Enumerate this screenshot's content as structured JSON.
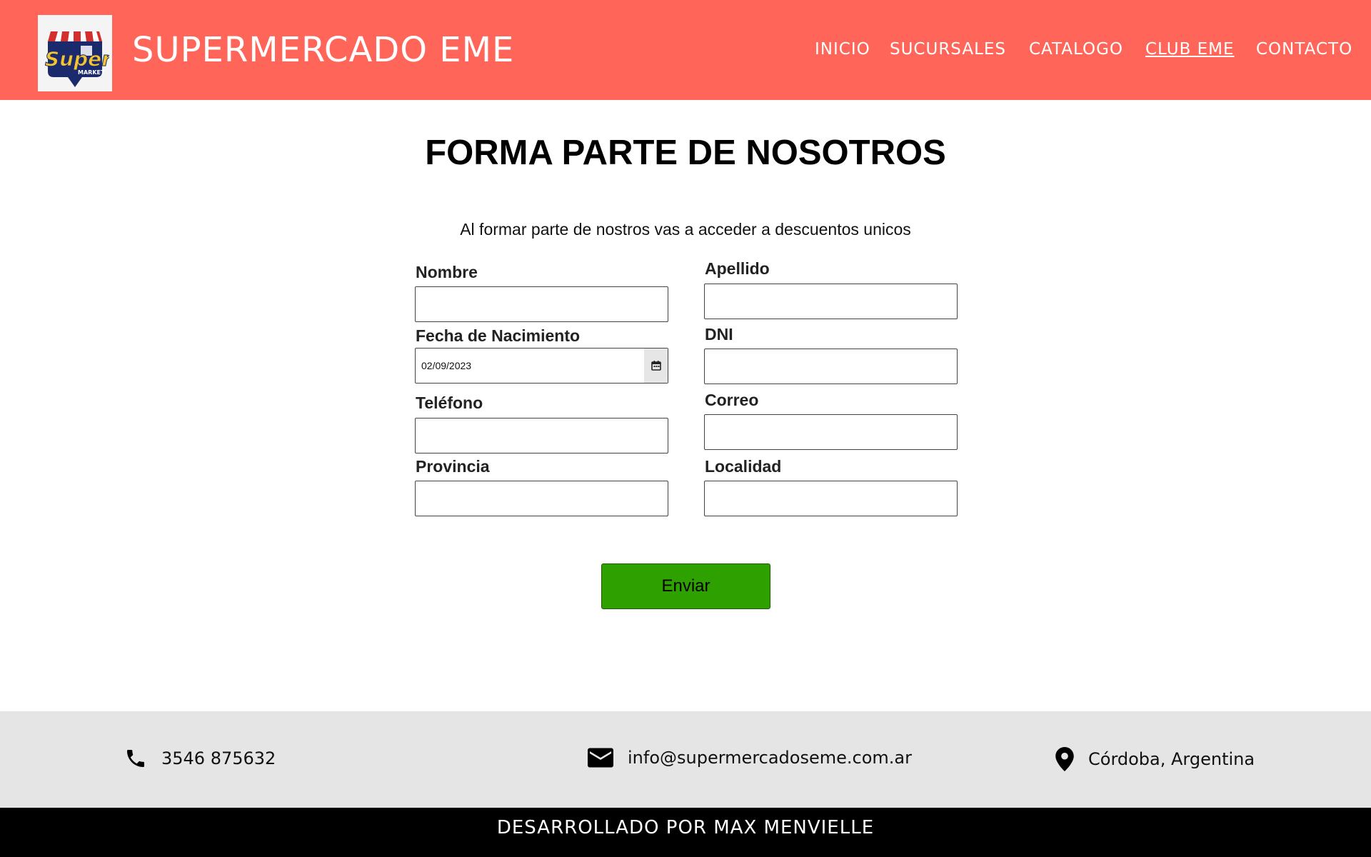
{
  "header": {
    "brand": "SUPERMERCADO EME",
    "logo_text": "Super",
    "logo_subtext": "MARKET",
    "background_color": "#ff6659",
    "nav": [
      {
        "label": "INICIO",
        "active": false
      },
      {
        "label": "SUCURSALES",
        "active": false
      },
      {
        "label": "CATALOGO",
        "active": false
      },
      {
        "label": "CLUB EME",
        "active": true
      },
      {
        "label": "CONTACTO",
        "active": false
      }
    ]
  },
  "main": {
    "title": "FORMA PARTE DE NOSOTROS",
    "subtitle": "Al formar parte de nostros vas a acceder a descuentos unicos",
    "form": {
      "nombre_label": "Nombre",
      "apellido_label": "Apellido",
      "fecha_label": "Fecha de Nacimiento",
      "fecha_value": "02/09/2023",
      "dni_label": "DNI",
      "telefono_label": "Teléfono",
      "correo_label": "Correo",
      "provincia_label": "Provincia",
      "localidad_label": "Localidad",
      "submit_label": "Enviar",
      "submit_color": "#2ea100"
    }
  },
  "footer": {
    "phone": "3546 875632",
    "email": "info@supermercadoseme.com.ar",
    "location": "Córdoba, Argentina",
    "credits": "DESARROLLADO POR MAX MENVIELLE",
    "phone_icon": "phone-icon",
    "email_icon": "mail-icon",
    "location_icon": "location-pin-icon"
  }
}
